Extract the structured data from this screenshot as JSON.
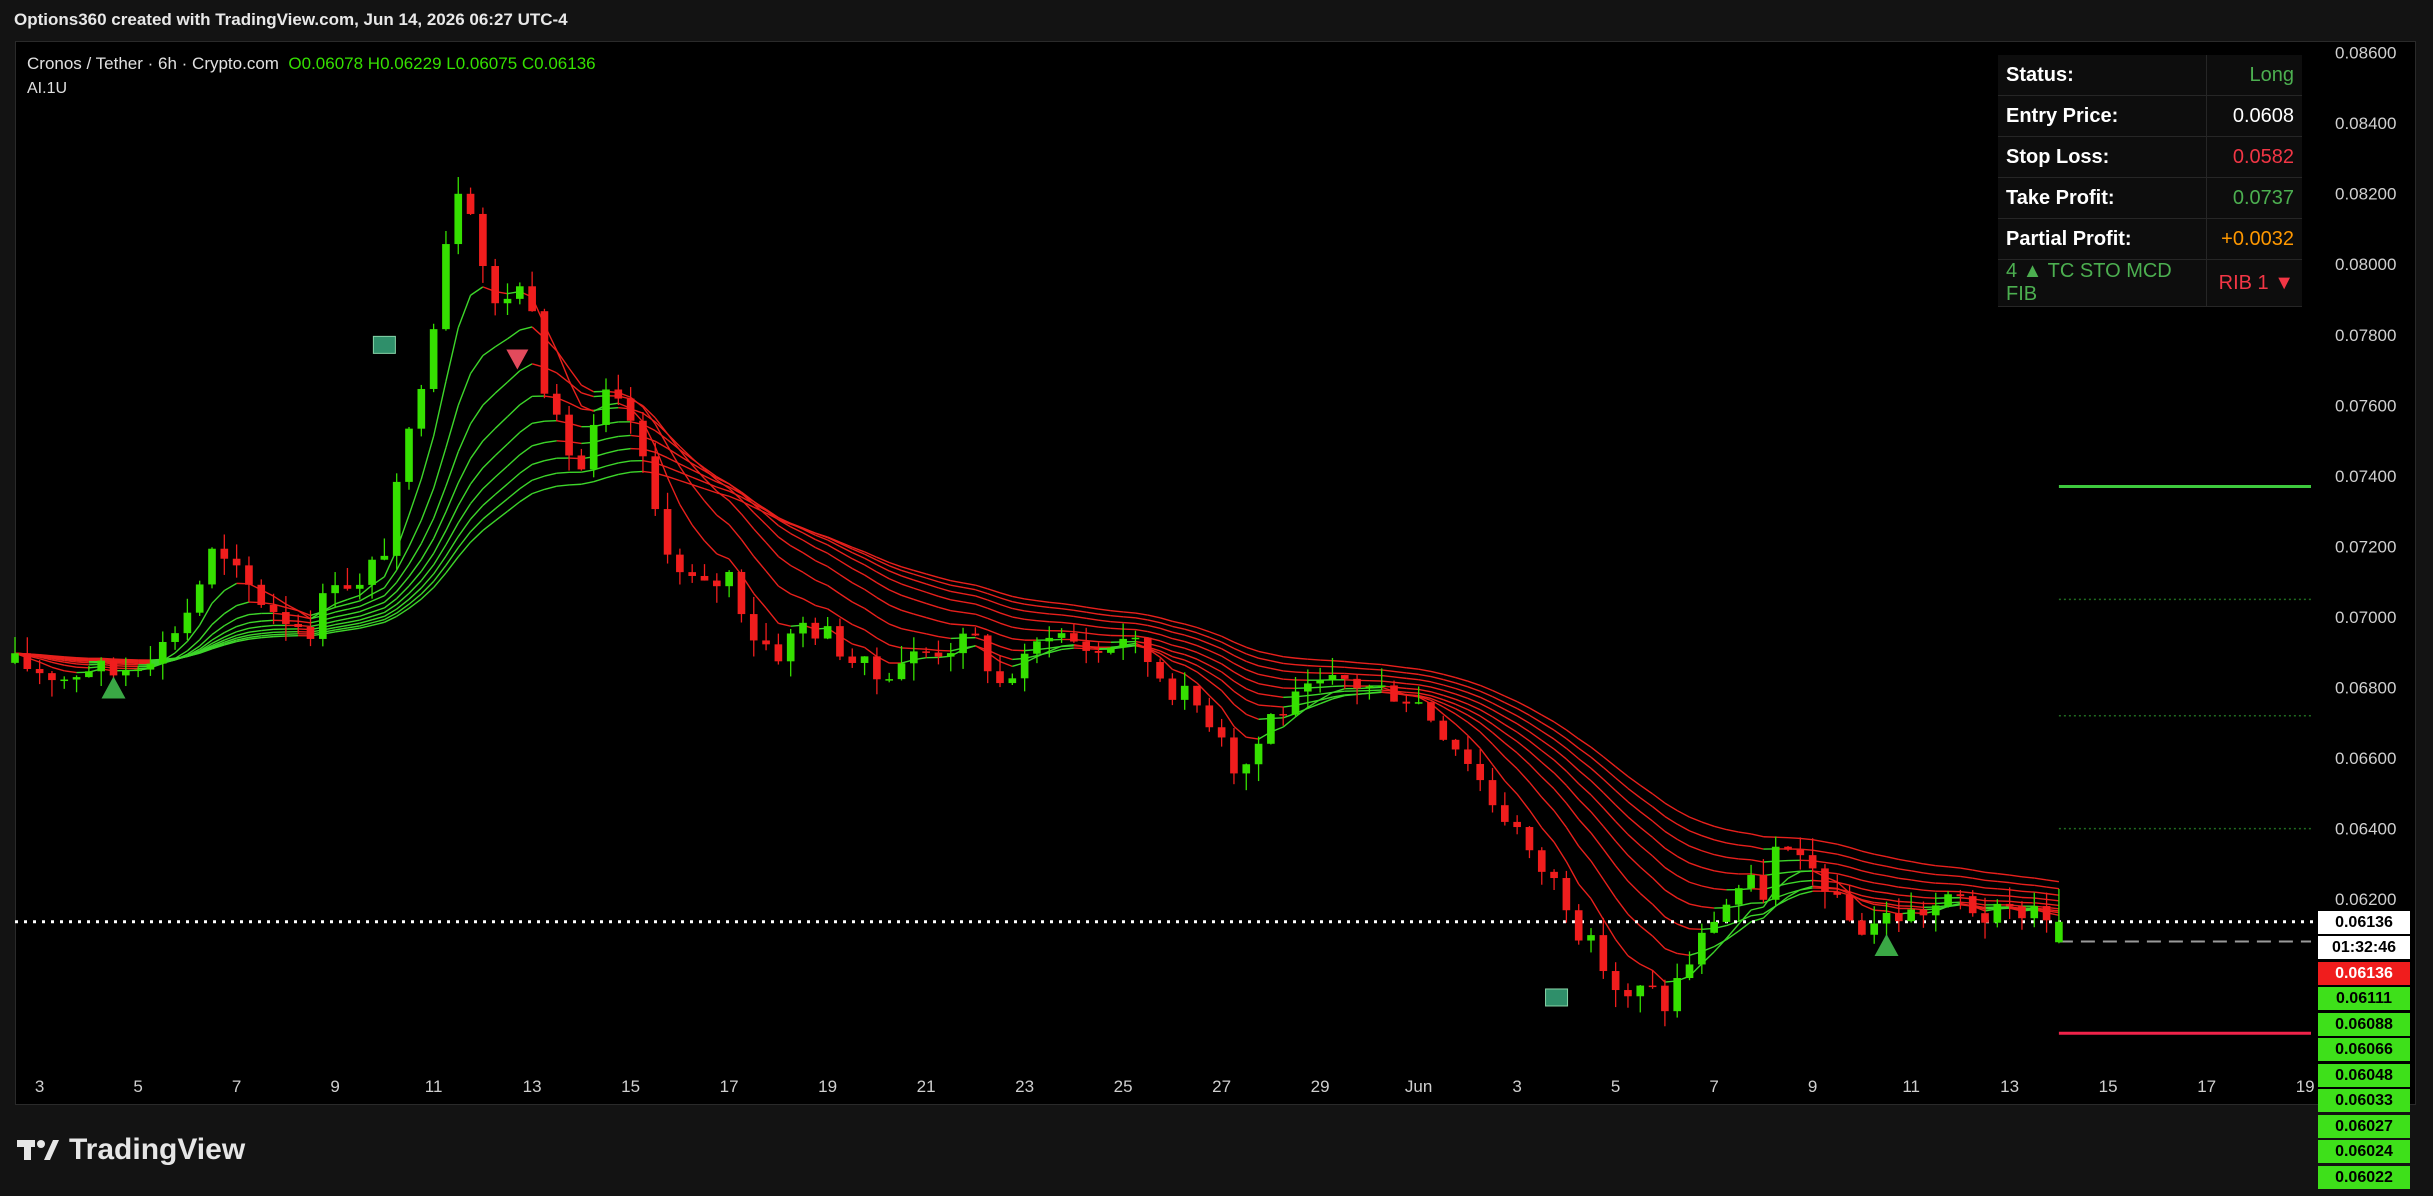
{
  "header": {
    "credit": "Options360 created with TradingView.com, Jun 14, 2026 06:27 UTC-4",
    "logo_text": "TradingView"
  },
  "legend": {
    "symbol": "Cronos / Tether · 6h · Crypto.com",
    "ohlc": "O0.06078 H0.06229 L0.06075 C0.06136",
    "indicator": "AI.1U"
  },
  "info_table": [
    {
      "label": "Status:",
      "value": "Long",
      "color": "#4caf50"
    },
    {
      "label": "Entry Price:",
      "value": "0.0608",
      "color": "#ffffff"
    },
    {
      "label": "Stop Loss:",
      "value": "0.0582",
      "color": "#f23645"
    },
    {
      "label": "Take Profit:",
      "value": "0.0737",
      "color": "#4caf50"
    },
    {
      "label": "Partial Profit:",
      "value": "+0.0032",
      "color": "#ff9800"
    },
    {
      "label": "4 ▲ TC STO MCD FIB",
      "value": "RIB 1 ▼",
      "label_color": "#4caf50",
      "color": "#f23645"
    }
  ],
  "price_tags": [
    {
      "text": "0.06136",
      "bg": "#ffffff",
      "fg": "#000000"
    },
    {
      "text": "01:32:46",
      "bg": "#ffffff",
      "fg": "#000000"
    },
    {
      "text": "0.06136",
      "bg": "#f01d1d",
      "fg": "#ffffff"
    },
    {
      "text": "0.06111",
      "bg": "#3ee01a",
      "fg": "#000000"
    },
    {
      "text": "0.06088",
      "bg": "#3ee01a",
      "fg": "#000000"
    },
    {
      "text": "0.06066",
      "bg": "#3ee01a",
      "fg": "#000000"
    },
    {
      "text": "0.06048",
      "bg": "#3ee01a",
      "fg": "#000000"
    },
    {
      "text": "0.06033",
      "bg": "#3ee01a",
      "fg": "#000000"
    },
    {
      "text": "0.06027",
      "bg": "#3ee01a",
      "fg": "#000000"
    },
    {
      "text": "0.06024",
      "bg": "#3ee01a",
      "fg": "#000000"
    },
    {
      "text": "0.06022",
      "bg": "#3ee01a",
      "fg": "#000000"
    }
  ],
  "chart_data": {
    "type": "candlestick",
    "interval": "6h",
    "ylim": [
      0.0573,
      0.0863
    ],
    "y_ticks": [
      0.086,
      0.084,
      0.082,
      0.08,
      0.078,
      0.076,
      0.074,
      0.072,
      0.07,
      0.068,
      0.066,
      0.064,
      0.062
    ],
    "y_tick_labels": [
      "0.08600",
      "0.08400",
      "0.08200",
      "0.08000",
      "0.07800",
      "0.07600",
      "0.07400",
      "0.07200",
      "0.07000",
      "0.06800",
      "0.06600",
      "0.06400",
      "0.06200"
    ],
    "x_ticks": [
      {
        "day": 3,
        "label": "3"
      },
      {
        "day": 5,
        "label": "5"
      },
      {
        "day": 7,
        "label": "7"
      },
      {
        "day": 9,
        "label": "9"
      },
      {
        "day": 11,
        "label": "11"
      },
      {
        "day": 13,
        "label": "13"
      },
      {
        "day": 15,
        "label": "15"
      },
      {
        "day": 17,
        "label": "17"
      },
      {
        "day": 19,
        "label": "19"
      },
      {
        "day": 21,
        "label": "21"
      },
      {
        "day": 23,
        "label": "23"
      },
      {
        "day": 25,
        "label": "25"
      },
      {
        "day": 27,
        "label": "27"
      },
      {
        "day": 29,
        "label": "29"
      },
      {
        "day": 31,
        "label": "Jun"
      },
      {
        "day": 33,
        "label": "3"
      },
      {
        "day": 35,
        "label": "5"
      },
      {
        "day": 37,
        "label": "7"
      },
      {
        "day": 39,
        "label": "9"
      },
      {
        "day": 41,
        "label": "11"
      },
      {
        "day": 43,
        "label": "13"
      },
      {
        "day": 45,
        "label": "15"
      },
      {
        "day": 47,
        "label": "17"
      },
      {
        "day": 49,
        "label": "19"
      }
    ],
    "xlim": [
      2.5,
      49.2
    ],
    "last_price": 0.06136,
    "take_profit": 0.0737,
    "stop_loss": 0.0582,
    "entry_price": 0.0608,
    "target_levels": [
      0.0705,
      0.0672,
      0.064
    ],
    "ribbon_bands": 9,
    "close_path": [
      [
        2.5,
        0.0687
      ],
      [
        3.0,
        0.0685
      ],
      [
        3.5,
        0.0683
      ],
      [
        4.0,
        0.0686
      ],
      [
        4.5,
        0.0684
      ],
      [
        5.0,
        0.0688
      ],
      [
        5.5,
        0.0692
      ],
      [
        6.0,
        0.0702
      ],
      [
        6.5,
        0.0718
      ],
      [
        7.0,
        0.0712
      ],
      [
        7.5,
        0.0705
      ],
      [
        8.0,
        0.07
      ],
      [
        8.5,
        0.0697
      ],
      [
        9.0,
        0.0712
      ],
      [
        9.5,
        0.0708
      ],
      [
        10.0,
        0.072
      ],
      [
        10.3,
        0.0738
      ],
      [
        10.6,
        0.0758
      ],
      [
        11.0,
        0.0785
      ],
      [
        11.3,
        0.0812
      ],
      [
        11.6,
        0.0828
      ],
      [
        12.0,
        0.08
      ],
      [
        12.3,
        0.0785
      ],
      [
        12.6,
        0.0795
      ],
      [
        13.0,
        0.079
      ],
      [
        13.3,
        0.0762
      ],
      [
        13.6,
        0.075
      ],
      [
        14.0,
        0.0742
      ],
      [
        14.5,
        0.0762
      ],
      [
        15.0,
        0.0756
      ],
      [
        15.5,
        0.073
      ],
      [
        16.0,
        0.0712
      ],
      [
        16.5,
        0.0708
      ],
      [
        17.0,
        0.0712
      ],
      [
        17.5,
        0.0695
      ],
      [
        18.0,
        0.069
      ],
      [
        18.5,
        0.0698
      ],
      [
        19.0,
        0.0695
      ],
      [
        19.5,
        0.0688
      ],
      [
        20.0,
        0.0683
      ],
      [
        20.5,
        0.0688
      ],
      [
        21.0,
        0.069
      ],
      [
        21.5,
        0.0692
      ],
      [
        22.0,
        0.0693
      ],
      [
        22.5,
        0.0681
      ],
      [
        23.0,
        0.0687
      ],
      [
        23.5,
        0.0697
      ],
      [
        24.0,
        0.0693
      ],
      [
        24.5,
        0.069
      ],
      [
        25.0,
        0.0695
      ],
      [
        25.5,
        0.0688
      ],
      [
        26.0,
        0.068
      ],
      [
        26.5,
        0.0675
      ],
      [
        27.0,
        0.0668
      ],
      [
        27.3,
        0.0656
      ],
      [
        27.6,
        0.066
      ],
      [
        28.0,
        0.0672
      ],
      [
        28.5,
        0.0676
      ],
      [
        29.0,
        0.068
      ],
      [
        29.5,
        0.0682
      ],
      [
        30.0,
        0.068
      ],
      [
        30.5,
        0.0679
      ],
      [
        31.0,
        0.0676
      ],
      [
        31.5,
        0.0668
      ],
      [
        32.0,
        0.066
      ],
      [
        32.5,
        0.0648
      ],
      [
        33.0,
        0.064
      ],
      [
        33.3,
        0.063
      ],
      [
        33.6,
        0.0628
      ],
      [
        34.0,
        0.062
      ],
      [
        34.3,
        0.061
      ],
      [
        34.6,
        0.0605
      ],
      [
        35.0,
        0.0595
      ],
      [
        35.3,
        0.059
      ],
      [
        35.6,
        0.0596
      ],
      [
        36.0,
        0.059
      ],
      [
        36.3,
        0.0598
      ],
      [
        36.6,
        0.0605
      ],
      [
        37.0,
        0.0615
      ],
      [
        37.3,
        0.062
      ],
      [
        37.6,
        0.0625
      ],
      [
        38.0,
        0.0622
      ],
      [
        38.3,
        0.0636
      ],
      [
        38.6,
        0.063
      ],
      [
        39.0,
        0.0628
      ],
      [
        39.3,
        0.0624
      ],
      [
        39.6,
        0.0615
      ],
      [
        40.0,
        0.0612
      ],
      [
        40.5,
        0.0615
      ],
      [
        41.0,
        0.0616
      ],
      [
        41.5,
        0.0618
      ],
      [
        42.0,
        0.062
      ],
      [
        42.5,
        0.0615
      ],
      [
        43.0,
        0.0616
      ],
      [
        43.5,
        0.0618
      ],
      [
        44.0,
        0.06136
      ]
    ],
    "signals": [
      {
        "kind": "buy-triangle",
        "day": 4.5,
        "price": 0.068
      },
      {
        "kind": "sell-triangle",
        "day": 12.7,
        "price": 0.0773
      },
      {
        "kind": "buy-triangle",
        "day": 40.5,
        "price": 0.0607
      },
      {
        "kind": "flag",
        "day": 10.0,
        "price": 0.0777
      },
      {
        "kind": "flag",
        "day": 33.8,
        "price": 0.0592
      }
    ]
  }
}
